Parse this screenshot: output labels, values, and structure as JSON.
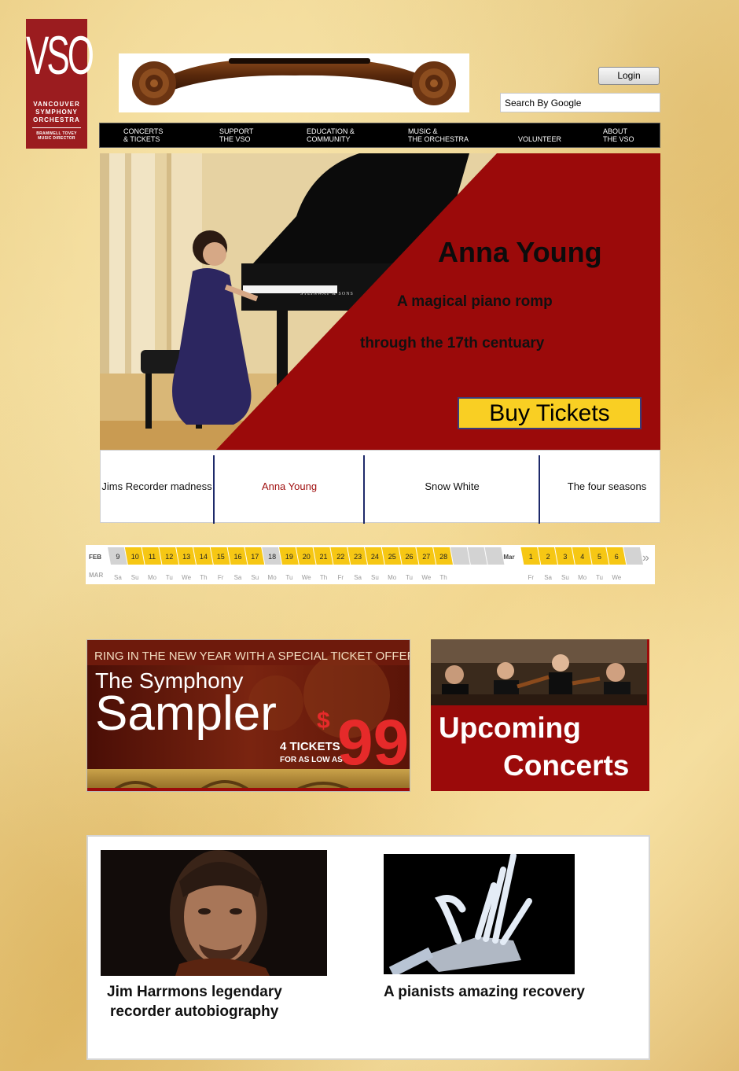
{
  "logo": {
    "mark": "VSO",
    "name_lines": [
      "VANCOUVER",
      "SYMPHONY",
      "ORCHESTRA"
    ],
    "director_lines": [
      "BRAMWELL TOVEY",
      "MUSIC DIRECTOR"
    ]
  },
  "header": {
    "login_label": "Login",
    "search_value": "Search By Google"
  },
  "nav": {
    "items": [
      {
        "line1": "CONCERTS",
        "line2": "& TICKETS"
      },
      {
        "line1": "SUPPORT",
        "line2": "THE VSO"
      },
      {
        "line1": "EDUCATION &",
        "line2": "COMMUNITY"
      },
      {
        "line1": "MUSIC &",
        "line2": "THE ORCHESTRA"
      },
      {
        "line1": "",
        "line2": "VOLUNTEER"
      },
      {
        "line1": "ABOUT",
        "line2": "THE VSO"
      }
    ]
  },
  "hero": {
    "title": "Anna Young",
    "subtitle1": "A magical piano romp",
    "subtitle2": "through the 17th centuary",
    "button_label": "Buy Tickets",
    "piano_brand": "STEINWAY & SONS",
    "accent_color": "#9b0a0a"
  },
  "tabs": {
    "items": [
      {
        "label": "Jims Recorder madness",
        "active": false
      },
      {
        "label": "Anna Young",
        "active": true
      },
      {
        "label": "Snow White",
        "active": false
      },
      {
        "label": "The four seasons",
        "active": false
      }
    ],
    "active_color": "#a01010"
  },
  "calendar": {
    "month1_label": "FEB",
    "month1_sub": "MAR",
    "month2_label": "Mar",
    "feb_days": [
      {
        "d": "9",
        "w": "Sa",
        "avail": false
      },
      {
        "d": "10",
        "w": "Su",
        "avail": true
      },
      {
        "d": "11",
        "w": "Mo",
        "avail": true
      },
      {
        "d": "12",
        "w": "Tu",
        "avail": true
      },
      {
        "d": "13",
        "w": "We",
        "avail": true
      },
      {
        "d": "14",
        "w": "Th",
        "avail": true
      },
      {
        "d": "15",
        "w": "Fr",
        "avail": true
      },
      {
        "d": "16",
        "w": "Sa",
        "avail": true
      },
      {
        "d": "17",
        "w": "Su",
        "avail": true
      },
      {
        "d": "18",
        "w": "Mo",
        "avail": false
      },
      {
        "d": "19",
        "w": "Tu",
        "avail": true
      },
      {
        "d": "20",
        "w": "We",
        "avail": true
      },
      {
        "d": "21",
        "w": "Th",
        "avail": true
      },
      {
        "d": "22",
        "w": "Fr",
        "avail": true
      },
      {
        "d": "23",
        "w": "Sa",
        "avail": true
      },
      {
        "d": "24",
        "w": "Su",
        "avail": true
      },
      {
        "d": "25",
        "w": "Mo",
        "avail": true
      },
      {
        "d": "26",
        "w": "Tu",
        "avail": true
      },
      {
        "d": "27",
        "w": "We",
        "avail": true
      },
      {
        "d": "28",
        "w": "Th",
        "avail": true
      }
    ],
    "mar_days": [
      {
        "d": "1",
        "w": "Fr",
        "avail": true
      },
      {
        "d": "2",
        "w": "Sa",
        "avail": true
      },
      {
        "d": "3",
        "w": "Su",
        "avail": true
      },
      {
        "d": "4",
        "w": "Mo",
        "avail": true
      },
      {
        "d": "5",
        "w": "Tu",
        "avail": true
      },
      {
        "d": "6",
        "w": "We",
        "avail": true
      }
    ],
    "next_icon": "»",
    "avail_color": "#f6c714",
    "unavail_color": "#d3d3d3"
  },
  "promo": {
    "sampler": {
      "banner": "RING IN THE NEW YEAR WITH A SPECIAL TICKET OFFER!",
      "line1": "The Symphony",
      "line2": "Sampler",
      "tickets": "4 TICKETS",
      "as_low": "FOR AS LOW AS",
      "currency": "$",
      "price": "99"
    },
    "upcoming": {
      "line1": "Upcoming",
      "line2": "Concerts"
    }
  },
  "articles": [
    {
      "title_lines": [
        "Jim Harrmons legendary",
        "recorder autobiography"
      ]
    },
    {
      "title_lines": [
        "A pianists amazing recovery"
      ]
    }
  ]
}
